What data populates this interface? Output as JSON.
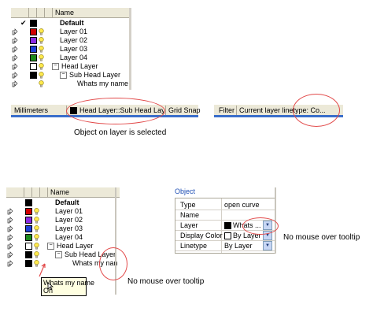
{
  "panel1": {
    "col_name": "Name",
    "layers": [
      {
        "name": "Default",
        "color": "#000000",
        "bold": true,
        "check": "✔"
      },
      {
        "name": "Layer 01",
        "color": "#d00000"
      },
      {
        "name": "Layer 02",
        "color": "#8a2be2"
      },
      {
        "name": "Layer 03",
        "color": "#1e3fd6"
      },
      {
        "name": "Layer 04",
        "color": "#1c8a1c"
      },
      {
        "name": "Head Layer",
        "color": "#ffffff",
        "minus": "−"
      },
      {
        "name": "Sub Head Layer",
        "color": "#000000",
        "minus": "−"
      },
      {
        "name": "Whats my name",
        "color": null
      }
    ]
  },
  "statusbar1": {
    "units": "Millimeters",
    "current_layer": "Head Layer::Sub Head Layer",
    "grid_snap": "Grid Snap"
  },
  "statusbar2": {
    "filter": "Filter",
    "linetype": "Current layer linetype: Co..."
  },
  "caption1": "Object on layer is selected",
  "panel2": {
    "col_name": "Name",
    "layers": [
      {
        "name": "Default",
        "color": "#000000",
        "bold": true
      },
      {
        "name": "Layer 01",
        "color": "#d00000"
      },
      {
        "name": "Layer 02",
        "color": "#8a2be2"
      },
      {
        "name": "Layer 03",
        "color": "#1e3fd6"
      },
      {
        "name": "Layer 04",
        "color": "#1c8a1c"
      },
      {
        "name": "Head Layer",
        "color": "#ffffff",
        "minus": "−"
      },
      {
        "name": "Sub Head Layer",
        "color": "#000000",
        "minus": "−"
      },
      {
        "name": "Whats my nan",
        "color": "#000000"
      }
    ],
    "tooltip_line1": "Whats my name",
    "tooltip_line2": "On"
  },
  "caption2": "No mouse over tooltip",
  "properties": {
    "title": "Object",
    "rows": [
      {
        "key": "Type",
        "value": "open curve"
      },
      {
        "key": "Name",
        "value": ""
      },
      {
        "key": "Layer",
        "value": "Whats ..."
      },
      {
        "key": "Display Color",
        "value": "By Layer"
      },
      {
        "key": "Linetype",
        "value": "By Layer"
      }
    ]
  },
  "caption3": "No mouse over tooltip",
  "colors": {
    "accent": "#3a6ecb",
    "annotation": "#e24a4a",
    "title_blue": "#1f4fb4"
  }
}
